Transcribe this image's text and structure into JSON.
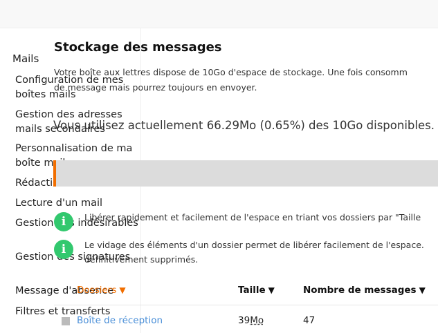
{
  "sidebar": {
    "heading": "Mails",
    "items": [
      {
        "label": "Configuration de mes boîtes mails"
      },
      {
        "label": "Gestion des adresses mails secondaires"
      },
      {
        "label": "Personnalisation de ma boîte mail"
      },
      {
        "label": "Rédaction"
      },
      {
        "label": "Lecture d'un mail"
      },
      {
        "label": "Gestion des indésirables"
      },
      {
        "label": "Gestion des signatures"
      },
      {
        "label": "Message d'absence"
      },
      {
        "label": "Filtres et transferts"
      }
    ]
  },
  "page": {
    "title": "Stockage des messages",
    "description_line1": "Votre boîte aux lettres dispose de 10Go d'espace de stockage. Une fois consomm",
    "description_line2": "de message mais pourrez toujours en envoyer.",
    "usage_text": "Vous utilisez actuellement 66.29Mo (0.65%) des 10Go disponibles.",
    "usage_fraction": 0.0065
  },
  "tips": [
    {
      "icon": "info-icon",
      "line1": "Libérer rapidement et facilement de l'espace en triant vos dossiers par \"Taille",
      "line2": ""
    },
    {
      "icon": "info-icon",
      "line1": "Le vidage des éléments d'un dossier permet de libérer facilement de l'espace.",
      "line2": "définitivement supprimés."
    }
  ],
  "table": {
    "columns": [
      {
        "label": "Dossiers",
        "sort_icon": "▼"
      },
      {
        "label": "Taille",
        "sort_icon": "▼"
      },
      {
        "label": "Nombre de messages",
        "sort_icon": "▼"
      }
    ],
    "rows": [
      {
        "folder": "Boîte de réception",
        "size_value": "39",
        "size_unit": "Mo",
        "count": "47"
      }
    ]
  },
  "colors": {
    "accent": "#f16e00",
    "info_green": "#32c86e",
    "link": "#4a8fd8"
  }
}
